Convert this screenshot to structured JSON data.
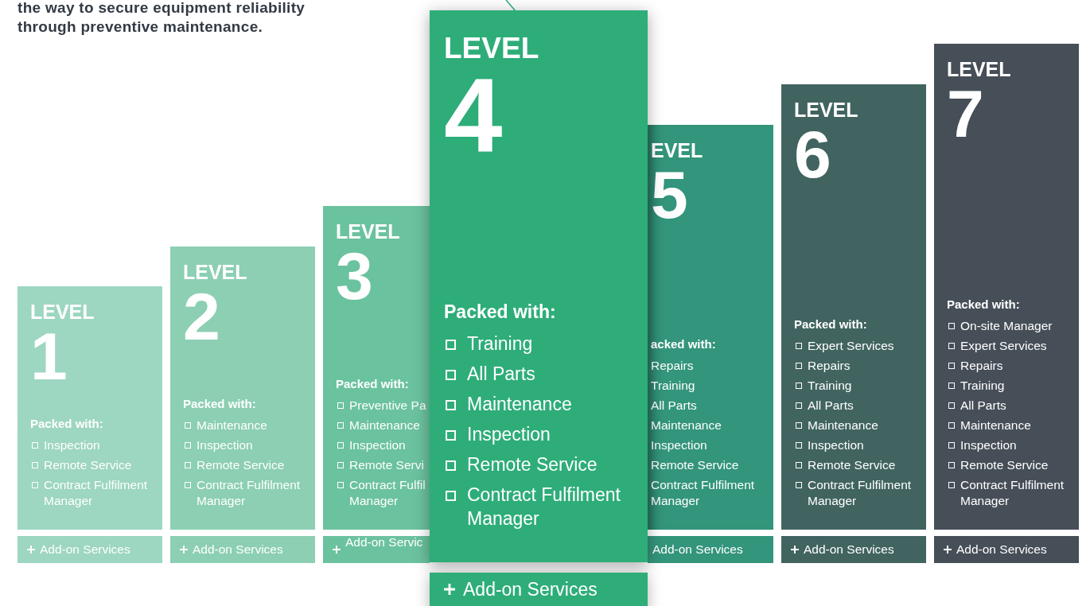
{
  "intro": {
    "lines": [
      "the way to secure equipment reliability",
      "through preventive maintenance."
    ]
  },
  "levels": [
    {
      "kind": "standard",
      "heading": "LEVEL",
      "number": "1",
      "packed_label": "Packed with:",
      "color": "#9dd6c1",
      "items": [
        "Inspection",
        "Remote Service",
        "Contract Fulfilment Manager"
      ],
      "addon": "Add-on Services"
    },
    {
      "kind": "standard",
      "heading": "LEVEL",
      "number": "2",
      "packed_label": "Packed with:",
      "color": "#8ccfb3",
      "items": [
        "Maintenance",
        "Inspection",
        "Remote Service",
        "Contract Fulfilment Manager"
      ],
      "addon": "Add-on Services"
    },
    {
      "kind": "covered_right",
      "heading": "LEVEL",
      "number": "3",
      "packed_label": "Packed with:",
      "color": "#6bc29f",
      "items": [
        "Preventive Pa",
        "Maintenance",
        "Inspection",
        "Remote Servi",
        "Contract Fulfil\nManager"
      ],
      "addon": "Add-on Servic"
    },
    {
      "kind": "featured",
      "heading": "LEVEL",
      "number": "4",
      "packed_label": "Packed with:",
      "color": "#2ead79",
      "items": [
        "Training",
        "All Parts",
        "Maintenance",
        "Inspection",
        "Remote Service",
        "Contract Fulfilment Manager"
      ],
      "addon": "Add-on Services"
    },
    {
      "kind": "covered_left",
      "heading": "EVEL",
      "number": "5",
      "packed_label": "acked with:",
      "color": "#33957b",
      "items": [
        "Repairs",
        "Training",
        "All Parts",
        "Maintenance",
        "Inspection",
        "Remote Service",
        "Contract Fulfilment Manager"
      ],
      "addon": "Add-on Services"
    },
    {
      "kind": "standard",
      "heading": "LEVEL",
      "number": "6",
      "packed_label": "Packed with:",
      "color": "#416460",
      "items": [
        "Expert Services",
        "Repairs",
        "Training",
        "All Parts",
        "Maintenance",
        "Inspection",
        "Remote Service",
        "Contract Fulfilment Manager"
      ],
      "addon": "Add-on Services"
    },
    {
      "kind": "standard",
      "heading": "LEVEL",
      "number": "7",
      "packed_label": "Packed with:",
      "color": "#464f58",
      "items": [
        "On-site Manager",
        "Expert Services",
        "Repairs",
        "Training",
        "All Parts",
        "Maintenance",
        "Inspection",
        "Remote Service",
        "Contract Fulfilment Manager"
      ],
      "addon": "Add-on Services"
    }
  ]
}
